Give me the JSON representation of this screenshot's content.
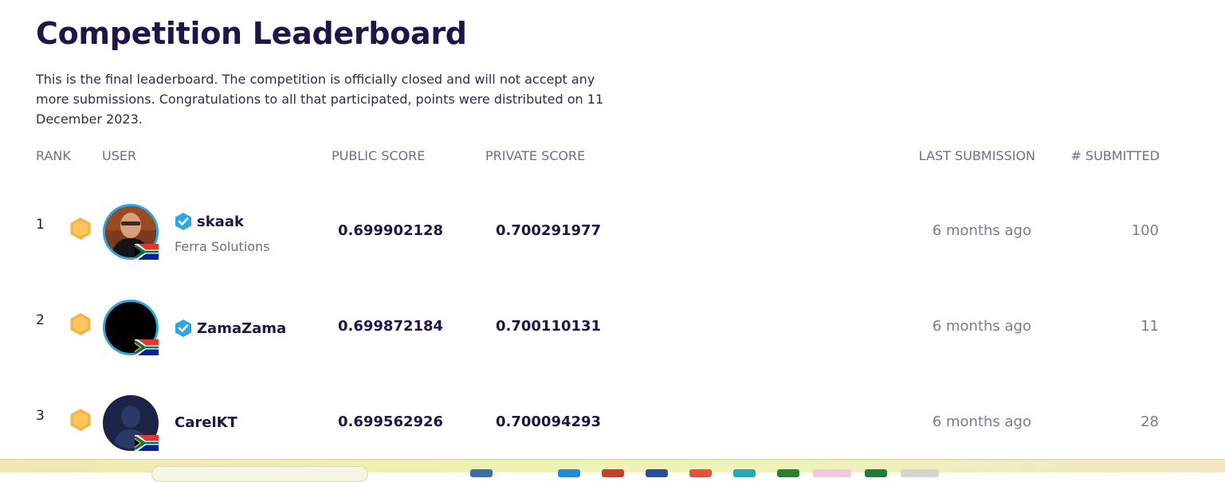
{
  "page": {
    "title": "Competition Leaderboard",
    "intro": "This is the final leaderboard. The competition is officially closed and will not accept any more submissions. Congratulations to all that participated, points were distributed on 11 December 2023."
  },
  "columns": {
    "rank": "RANK",
    "user": "USER",
    "public_score": "PUBLIC SCORE",
    "private_score": "PRIVATE SCORE",
    "last_submission": "LAST SUBMISSION",
    "submitted": "# SUBMITTED"
  },
  "rows": [
    {
      "rank": "1",
      "username": "skaak",
      "organization": "Ferra Solutions",
      "verified": true,
      "public_score": "0.699902128",
      "private_score": "0.700291977",
      "last_submission": "6 months ago",
      "submitted": "100"
    },
    {
      "rank": "2",
      "username": "ZamaZama",
      "organization": "",
      "verified": true,
      "public_score": "0.699872184",
      "private_score": "0.700110131",
      "last_submission": "6 months ago",
      "submitted": "11"
    },
    {
      "rank": "3",
      "username": "CarelKT",
      "organization": "",
      "verified": false,
      "public_score": "0.699562926",
      "private_score": "0.700094293",
      "last_submission": "6 months ago",
      "submitted": "28"
    }
  ],
  "colors": {
    "title": "#1f1547",
    "medal": "#f5b342",
    "verified_badge": "#2ea7e0",
    "avatar_ring": "#2ea7e0"
  },
  "icons": {
    "medal": "gold-hexagon-medal-icon",
    "verified": "verified-check-badge-icon",
    "flag": "south-africa-flag-icon"
  }
}
